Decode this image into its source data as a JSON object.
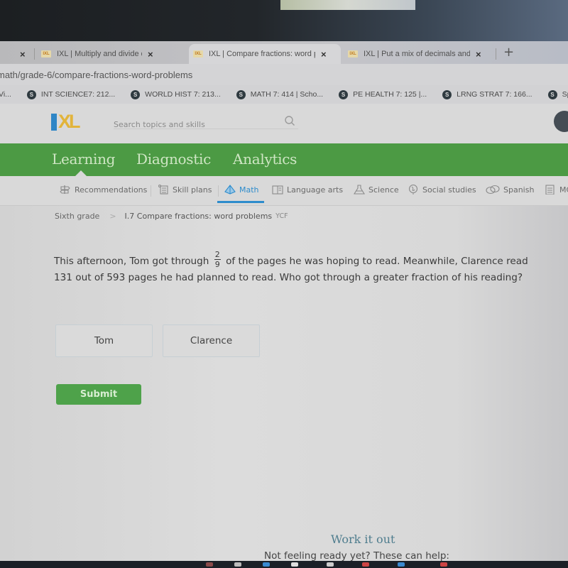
{
  "browser": {
    "tabs": [
      {
        "title": "",
        "closable": true,
        "active": false
      },
      {
        "title": "IXL | Multiply and divide decimals",
        "favicon": "IXL",
        "active": false
      },
      {
        "title": "IXL | Compare fractions: word problems",
        "favicon": "IXL",
        "active": true
      },
      {
        "title": "IXL | Put a mix of decimals and fractions",
        "favicon": "IXL",
        "active": false
      }
    ],
    "close_glyph": "×",
    "new_tab_glyph": "+",
    "url": "math/grade-6/compare-fractions-word-problems",
    "bookmarks": [
      {
        "label": "Vi...",
        "icon": ""
      },
      {
        "label": "INT SCIENCE7: 212...",
        "icon": "S"
      },
      {
        "label": "WORLD HIST 7: 213...",
        "icon": "S"
      },
      {
        "label": "MATH 7: 414 | Scho...",
        "icon": "S"
      },
      {
        "label": "PE HEALTH 7: 125 |...",
        "icon": "S"
      },
      {
        "label": "LRNG STRAT 7: 166...",
        "icon": "S"
      },
      {
        "label": "Speech Strat",
        "icon": "S"
      }
    ]
  },
  "header": {
    "logo_text": "XL",
    "search_placeholder": "Search topics and skills"
  },
  "main_nav": {
    "items": [
      {
        "label": "Learning",
        "active": true
      },
      {
        "label": "Diagnostic",
        "active": false
      },
      {
        "label": "Analytics",
        "active": false
      }
    ]
  },
  "subject_nav": {
    "items": [
      {
        "label": "Recommendations",
        "icon": "signpost-icon",
        "active": false
      },
      {
        "label": "Skill plans",
        "icon": "clipboard-icon",
        "active": false
      },
      {
        "label": "Math",
        "icon": "pyramid-icon",
        "active": true
      },
      {
        "label": "Language arts",
        "icon": "book-icon",
        "active": false
      },
      {
        "label": "Science",
        "icon": "flask-icon",
        "active": false
      },
      {
        "label": "Social studies",
        "icon": "globe-icon",
        "active": false
      },
      {
        "label": "Spanish",
        "icon": "speech-bubbles-icon",
        "active": false
      },
      {
        "label": "MC",
        "icon": "list-icon",
        "active": false
      }
    ],
    "accent_color": "#2e8ccc"
  },
  "breadcrumb": {
    "grade": "Sixth grade",
    "separator": ">",
    "skill": "I.7 Compare fractions: word problems",
    "code": "YCF"
  },
  "question": {
    "text_before": "This afternoon, Tom got through",
    "fraction": {
      "numerator": "2",
      "denominator": "9"
    },
    "text_after": "of the pages he was hoping to read. Meanwhile, Clarence read 131 out of 593 pages he had planned to read. Who got through a greater fraction of his reading?",
    "choices": [
      "Tom",
      "Clarence"
    ],
    "submit_label": "Submit"
  },
  "help": {
    "title": "Work it out",
    "subtitle": "Not feeling ready yet? These can help:"
  },
  "colors": {
    "nav_green": "#4c9a44",
    "submit_green": "#4ea24a",
    "logo_blue": "#2f86c6",
    "logo_gold": "#e2b43a"
  }
}
